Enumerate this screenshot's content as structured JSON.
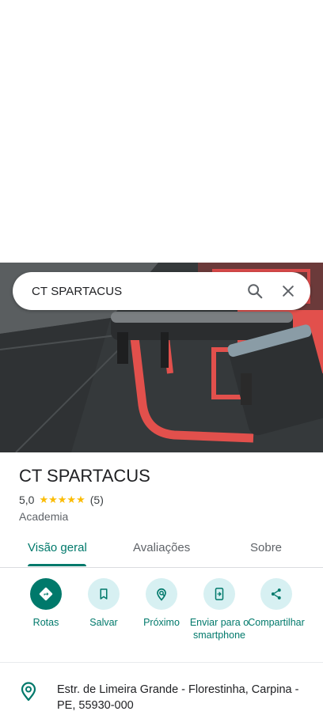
{
  "search": {
    "query": "CT SPARTACUS"
  },
  "place": {
    "name": "CT SPARTACUS",
    "rating": "5,0",
    "stars": "★★★★★",
    "review_count": "(5)",
    "category": "Academia"
  },
  "tabs": [
    {
      "label": "Visão geral",
      "active": true
    },
    {
      "label": "Avaliações",
      "active": false
    },
    {
      "label": "Sobre",
      "active": false
    }
  ],
  "actions": [
    {
      "label": "Rotas",
      "icon": "directions-icon"
    },
    {
      "label": "Salvar",
      "icon": "bookmark-icon"
    },
    {
      "label": "Próximo",
      "icon": "nearby-icon"
    },
    {
      "label": "Enviar para o smartphone",
      "icon": "send-to-phone-icon"
    },
    {
      "label": "Compartilhar",
      "icon": "share-icon"
    }
  ],
  "address": {
    "text": "Estr. de Limeira Grande - Florestinha, Carpina - PE, 55930-000"
  },
  "colors": {
    "accent": "#00796b",
    "action_bg": "#d7f0f2",
    "star": "#fbbc04"
  }
}
